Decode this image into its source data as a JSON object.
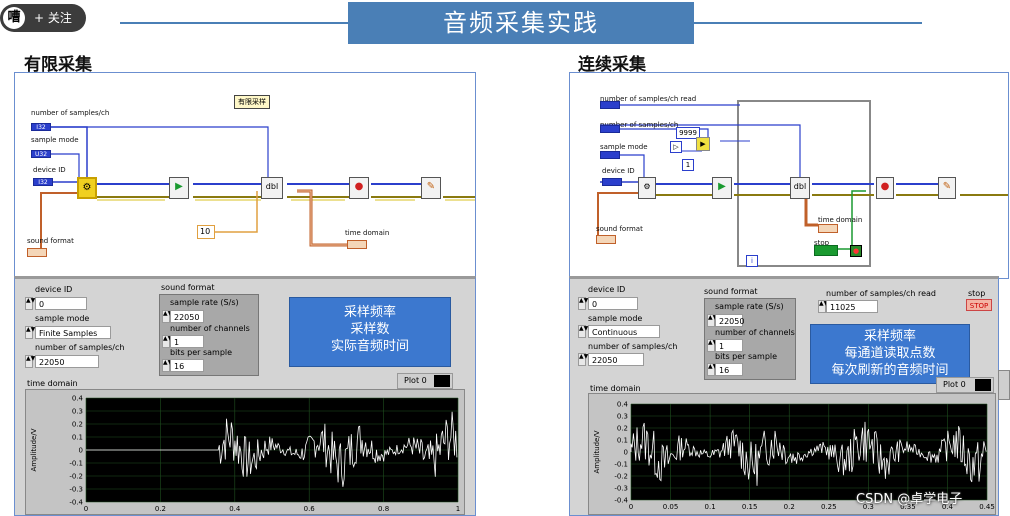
{
  "header": {
    "title": "音频采集实践",
    "follow_label": "关注",
    "avatar_glyph": "嘈"
  },
  "left": {
    "section_title": "有限采集",
    "diagram": {
      "lbl_samples": "number of samples/ch",
      "lbl_mode": "sample mode",
      "lbl_device": "device ID",
      "lbl_format": "sound format",
      "lbl_time": "time domain",
      "title_box": "有限采样",
      "const_10": "10",
      "term_i32": "I32",
      "term_u32": "U32",
      "term_tf": "TF"
    },
    "panel": {
      "device_label": "device ID",
      "device_value": "0",
      "mode_label": "sample mode",
      "mode_value": "Finite Samples",
      "samples_label": "number of samples/ch",
      "samples_value": "22050",
      "format_label": "sound format",
      "rate_label": "sample rate (S/s)",
      "rate_value": "22050",
      "channels_label": "number of channels",
      "channels_value": "1",
      "bits_label": "bits per sample",
      "bits_value": "16",
      "note_lines": [
        "采样频率",
        "采样数",
        "实际音频时间"
      ],
      "graph_label": "time domain",
      "plot_legend": "Plot 0",
      "y_axis_label": "Amplitude/V",
      "y_ticks": [
        "0.4",
        "0.3",
        "0.2",
        "0.1",
        "0",
        "-0.1",
        "-0.2",
        "-0.3",
        "-0.4"
      ],
      "x_ticks": [
        "0",
        "0.2",
        "0.4",
        "0.6",
        "0.8",
        "1"
      ]
    }
  },
  "right": {
    "section_title": "连续采集",
    "diagram": {
      "lbl_samples_read": "number of samples/ch read",
      "lbl_samples": "number of samples/ch",
      "lbl_mode": "sample mode",
      "lbl_device": "device ID",
      "lbl_format": "sound format",
      "lbl_time": "time domain",
      "lbl_stop": "stop",
      "const_9999": "9999",
      "const_1": "1",
      "const_i": "i"
    },
    "panel": {
      "device_label": "device ID",
      "device_value": "0",
      "mode_label": "sample mode",
      "mode_value": "Continuous",
      "samples_label": "number of samples/ch",
      "samples_value": "22050",
      "format_label": "sound format",
      "rate_label": "sample rate (S/s)",
      "rate_value": "22050",
      "channels_label": "number of channels",
      "channels_value": "1",
      "bits_label": "bits per sample",
      "bits_value": "16",
      "read_label": "number of samples/ch read",
      "read_value": "11025",
      "stop_label": "stop",
      "stop_button": "STOP",
      "note_lines": [
        "采样频率",
        "每通道读取点数",
        "每次刷新的音频时间"
      ],
      "graph_label": "time domain",
      "plot_legend": "Plot 0",
      "y_axis_label": "Amplitude/V",
      "y_ticks": [
        "0.4",
        "0.3",
        "0.2",
        "0.1",
        "0",
        "-0.1",
        "-0.2",
        "-0.3",
        "-0.4"
      ],
      "x_ticks": [
        "0",
        "0.05",
        "0.1",
        "0.15",
        "0.2",
        "0.25",
        "0.3",
        "0.35",
        "0.4",
        "0.45"
      ]
    }
  },
  "watermark": "CSDN @卓学电子",
  "colors": {
    "accent": "#4a7fb6",
    "wire_orange": "#c0602a",
    "wire_blue": "#2b3fcc",
    "wire_olive": "#8a7a10",
    "graph_bg": "#000000",
    "trace": "#ffffff"
  }
}
